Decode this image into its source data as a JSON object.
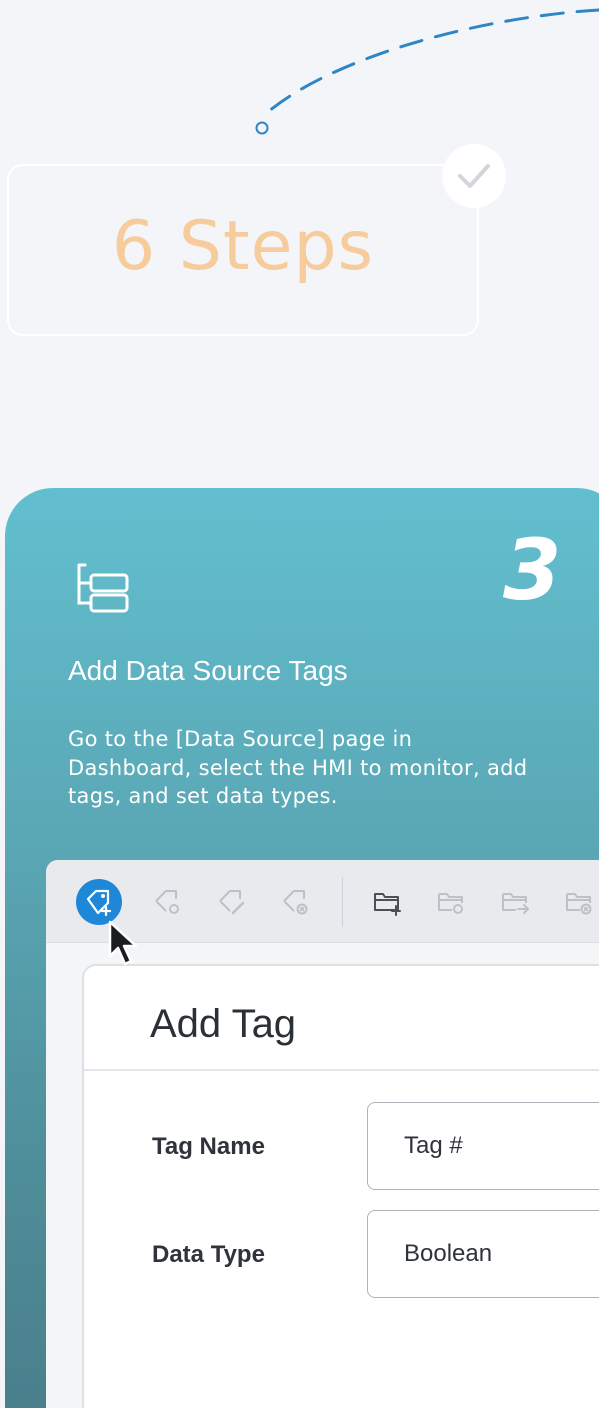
{
  "hero": {
    "title": "6 Steps"
  },
  "step": {
    "number": "3",
    "title": "Add Data Source Tags",
    "description": "Go to the [Data Source] page in Dashboard, select the HMI to monitor, add tags, and set data types."
  },
  "toolbar": {
    "icons": [
      "add-tag-icon",
      "tag-settings-icon",
      "tag-edit-icon",
      "tag-delete-icon",
      "add-folder-icon",
      "folder-settings-icon",
      "folder-move-icon",
      "folder-delete-icon"
    ]
  },
  "dialog": {
    "title": "Add Tag",
    "fields": [
      {
        "label": "Tag Name",
        "value": "Tag #"
      },
      {
        "label": "Data Type",
        "value": "Boolean"
      }
    ]
  },
  "colors": {
    "background": "#f4f5f9",
    "hero_text": "#f6cc9c",
    "card_top": "#62bfcf",
    "card_bottom": "#4a7f8c",
    "active_button": "#1f87d8"
  }
}
